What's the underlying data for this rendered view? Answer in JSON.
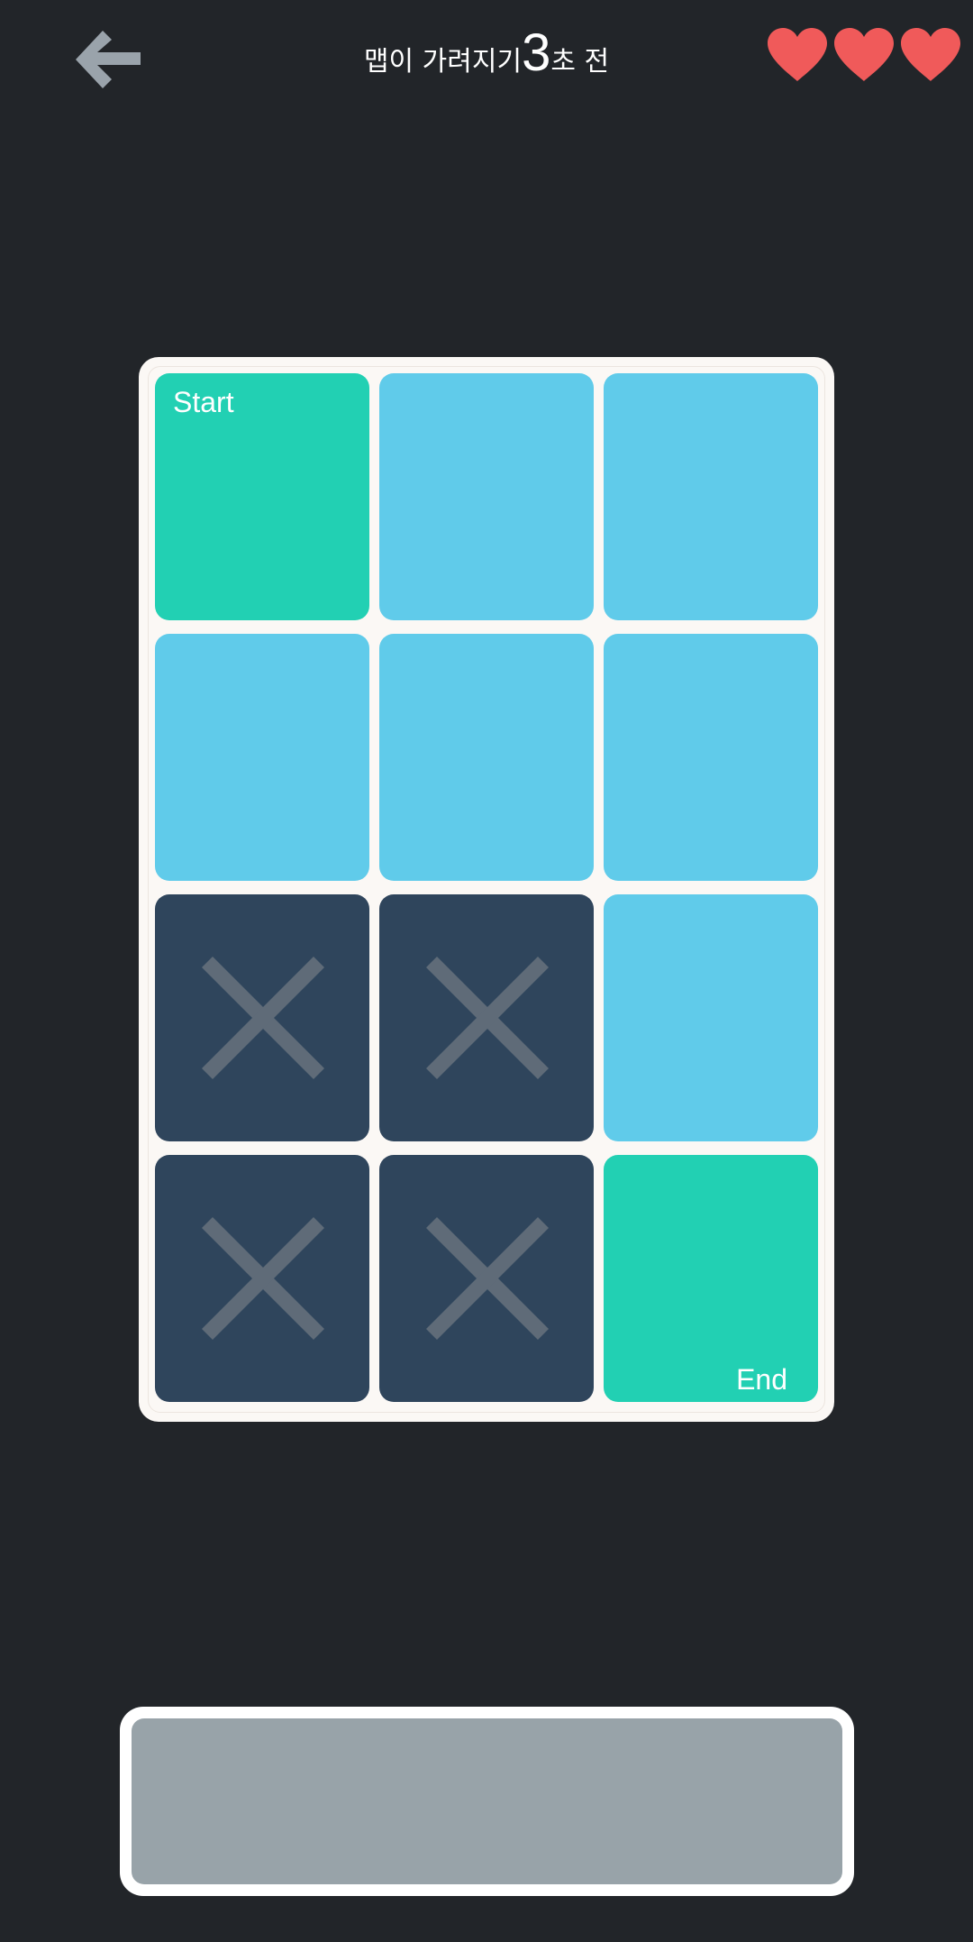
{
  "header": {
    "back_icon": "left-arrow-icon",
    "title_prefix": "맵이 가려지기",
    "countdown": "3",
    "title_suffix": "초 전",
    "lives": 3,
    "life_icon": "heart-icon",
    "heart_color": "#f05a5a"
  },
  "board": {
    "rows": 4,
    "cols": 3,
    "start_label": "Start",
    "end_label": "End",
    "cells": [
      [
        "start",
        "path",
        "path"
      ],
      [
        "path",
        "path",
        "path"
      ],
      [
        "blocked",
        "blocked",
        "path"
      ],
      [
        "blocked",
        "blocked",
        "end"
      ]
    ],
    "colors": {
      "path": "#60cbea",
      "endpoint": "#22d0b3",
      "blocked": "#2f455c",
      "x_mark": "#5f6b78",
      "board_bg": "#fbf8f5"
    }
  },
  "answer_area": {
    "color": "#98a3a9"
  }
}
